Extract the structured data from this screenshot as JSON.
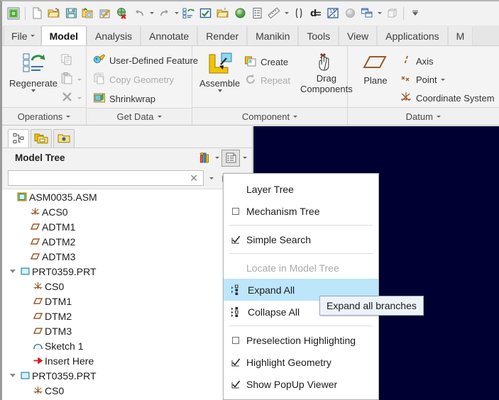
{
  "quick_access": {
    "items": [
      {
        "name": "creo-app-icon",
        "glyph": "app"
      },
      {
        "name": "new-file-icon",
        "glyph": "new"
      },
      {
        "name": "open-file-icon",
        "glyph": "open"
      },
      {
        "name": "save-icon",
        "glyph": "save"
      },
      {
        "name": "save-as-icon",
        "glyph": "saveas"
      },
      {
        "name": "print-icon",
        "glyph": "print"
      },
      {
        "name": "close-window-icon",
        "glyph": "closewin"
      },
      {
        "name": "undo-icon",
        "glyph": "undo"
      },
      {
        "name": "redo-icon",
        "glyph": "redo"
      },
      {
        "name": "regenerate-icon",
        "glyph": "regen"
      },
      {
        "name": "select-items-icon",
        "glyph": "selectitems"
      },
      {
        "name": "open-folder-icon",
        "glyph": "folderopen"
      },
      {
        "name": "shaded-sphere-icon",
        "glyph": "sphere"
      },
      {
        "name": "model-properties-icon",
        "glyph": "props"
      },
      {
        "name": "measure-icon",
        "glyph": "measure"
      },
      {
        "name": "parentheses-icon",
        "glyph": "paren"
      },
      {
        "name": "dimension-icon",
        "glyph": "dimension"
      },
      {
        "name": "relations-icon",
        "glyph": "relations"
      },
      {
        "name": "appearance-icon",
        "glyph": "appearance"
      },
      {
        "name": "window-layout-icon",
        "glyph": "windows"
      },
      {
        "name": "box-icon",
        "glyph": "box"
      },
      {
        "name": "customize-qat-icon",
        "glyph": "chevdown"
      }
    ]
  },
  "ribbon": {
    "tabs": [
      {
        "label": "File",
        "active": false,
        "has_caret": true
      },
      {
        "label": "Model",
        "active": true,
        "has_caret": false
      },
      {
        "label": "Analysis",
        "active": false,
        "has_caret": false
      },
      {
        "label": "Annotate",
        "active": false,
        "has_caret": false
      },
      {
        "label": "Render",
        "active": false,
        "has_caret": false
      },
      {
        "label": "Manikin",
        "active": false,
        "has_caret": false
      },
      {
        "label": "Tools",
        "active": false,
        "has_caret": false
      },
      {
        "label": "View",
        "active": false,
        "has_caret": false
      },
      {
        "label": "Applications",
        "active": false,
        "has_caret": false
      },
      {
        "label": "M",
        "active": false,
        "has_caret": false
      }
    ],
    "groups": [
      {
        "label": "Operations",
        "big_buttons": [
          {
            "label": "Regenerate",
            "icon": "regenerate-icon",
            "has_caret": true
          }
        ],
        "small_buttons": [
          {
            "label": "",
            "icon": "copy-icon",
            "disabled": true,
            "has_caret": false
          },
          {
            "label": "",
            "icon": "paste-icon",
            "disabled": true,
            "has_caret": true
          },
          {
            "label": "",
            "icon": "delete-icon",
            "disabled": true,
            "has_caret": true
          }
        ]
      },
      {
        "label": "Get Data",
        "small_buttons": [
          {
            "label": "User-Defined Feature",
            "icon": "user-defined-feature-icon",
            "disabled": false
          },
          {
            "label": "Copy Geometry",
            "icon": "copy-geometry-icon",
            "disabled": true
          },
          {
            "label": "Shrinkwrap",
            "icon": "shrinkwrap-icon",
            "disabled": false
          }
        ]
      },
      {
        "label": "Component",
        "big_buttons": [
          {
            "label": "Assemble",
            "icon": "assemble-icon",
            "has_caret": true
          },
          {
            "label": "Drag Components",
            "icon": "drag-components-icon",
            "has_caret": false
          }
        ],
        "small_buttons": [
          {
            "label": "Create",
            "icon": "create-component-icon",
            "disabled": false
          },
          {
            "label": "Repeat",
            "icon": "repeat-icon",
            "disabled": true
          }
        ]
      },
      {
        "label": "Datum",
        "big_buttons": [
          {
            "label": "Plane",
            "icon": "datum-plane-icon",
            "has_caret": false
          }
        ],
        "small_buttons": [
          {
            "label": "Axis",
            "icon": "datum-axis-icon",
            "disabled": false,
            "has_caret": false
          },
          {
            "label": "Point",
            "icon": "datum-point-icon",
            "disabled": false,
            "has_caret": true
          },
          {
            "label": "Coordinate System",
            "icon": "coordinate-system-icon",
            "disabled": false,
            "has_caret": false
          }
        ]
      }
    ]
  },
  "navigator": {
    "tabs": [
      {
        "name": "model-tree-tab",
        "icon": "model-tree-icon",
        "active": true
      },
      {
        "name": "folder-browser-tab",
        "icon": "folder-browser-icon",
        "active": false
      },
      {
        "name": "favorites-tab",
        "icon": "favorites-folder-icon",
        "active": false
      }
    ],
    "title": "Model Tree",
    "settings_icon": "tree-filters-icon",
    "display_icon": "tree-display-icon",
    "search": {
      "value": "",
      "placeholder": "",
      "clear_icon": "clear-icon",
      "find_icon": "find-binoculars-icon"
    },
    "tree": [
      {
        "label": "ASM0035.ASM",
        "icon": "assembly-icon",
        "indent": 0,
        "twisty": "none"
      },
      {
        "label": "ACS0",
        "icon": "coordinate-system-icon",
        "indent": 1,
        "twisty": "none"
      },
      {
        "label": "ADTM1",
        "icon": "datum-plane-icon",
        "indent": 1,
        "twisty": "none"
      },
      {
        "label": "ADTM2",
        "icon": "datum-plane-icon",
        "indent": 1,
        "twisty": "none"
      },
      {
        "label": "ADTM3",
        "icon": "datum-plane-icon",
        "indent": 1,
        "twisty": "none"
      },
      {
        "label": "PRT0359.PRT",
        "icon": "part-icon",
        "indent": 1,
        "twisty": "down"
      },
      {
        "label": "CS0",
        "icon": "coordinate-system-icon",
        "indent": 2,
        "twisty": "none"
      },
      {
        "label": "DTM1",
        "icon": "datum-plane-icon",
        "indent": 2,
        "twisty": "none"
      },
      {
        "label": "DTM2",
        "icon": "datum-plane-icon",
        "indent": 2,
        "twisty": "none"
      },
      {
        "label": "DTM3",
        "icon": "datum-plane-icon",
        "indent": 2,
        "twisty": "none"
      },
      {
        "label": "Sketch 1",
        "icon": "sketch-icon",
        "indent": 2,
        "twisty": "none"
      },
      {
        "label": "Insert Here",
        "icon": "insert-here-icon",
        "indent": 2,
        "twisty": "none"
      },
      {
        "label": "PRT0359.PRT",
        "icon": "part-icon",
        "indent": 1,
        "twisty": "down"
      },
      {
        "label": "CS0",
        "icon": "coordinate-system-icon",
        "indent": 2,
        "twisty": "none"
      }
    ]
  },
  "menu": {
    "items": [
      {
        "label": "Layer Tree",
        "type": "plain",
        "state": "none",
        "icon": "",
        "highlighted": false,
        "disabled": false
      },
      {
        "label": "Mechanism Tree",
        "type": "checkbox",
        "state": "unchecked",
        "icon": "",
        "highlighted": false,
        "disabled": false
      },
      {
        "type": "separator"
      },
      {
        "label": "Simple Search",
        "type": "checkbox",
        "state": "checked",
        "icon": "",
        "highlighted": false,
        "disabled": false
      },
      {
        "type": "separator"
      },
      {
        "label": "Locate in Model Tree",
        "type": "plain",
        "state": "none",
        "icon": "",
        "highlighted": false,
        "disabled": true
      },
      {
        "label": "Expand  All",
        "type": "icon",
        "state": "none",
        "icon": "expand-all-icon",
        "highlighted": true,
        "disabled": false
      },
      {
        "label": "Collapse All",
        "type": "icon",
        "state": "none",
        "icon": "collapse-all-icon",
        "highlighted": false,
        "disabled": false
      },
      {
        "type": "separator"
      },
      {
        "label": "Preselection Highlighting",
        "type": "checkbox",
        "state": "unchecked",
        "icon": "",
        "highlighted": false,
        "disabled": false
      },
      {
        "label": "Highlight Geometry",
        "type": "checkbox",
        "state": "checked",
        "icon": "",
        "highlighted": false,
        "disabled": false
      },
      {
        "label": "Show PopUp Viewer",
        "type": "checkbox",
        "state": "checked",
        "icon": "",
        "highlighted": false,
        "disabled": false
      }
    ]
  },
  "tooltip": {
    "text": "Expand all branches"
  },
  "colors": {
    "graphics_background": "#000033",
    "menu_highlight": "#bde6fb",
    "tooltip_background": "#eef3fa",
    "datum_brown": "#9c5a28",
    "ribbon_background": "#f4f4f4"
  }
}
